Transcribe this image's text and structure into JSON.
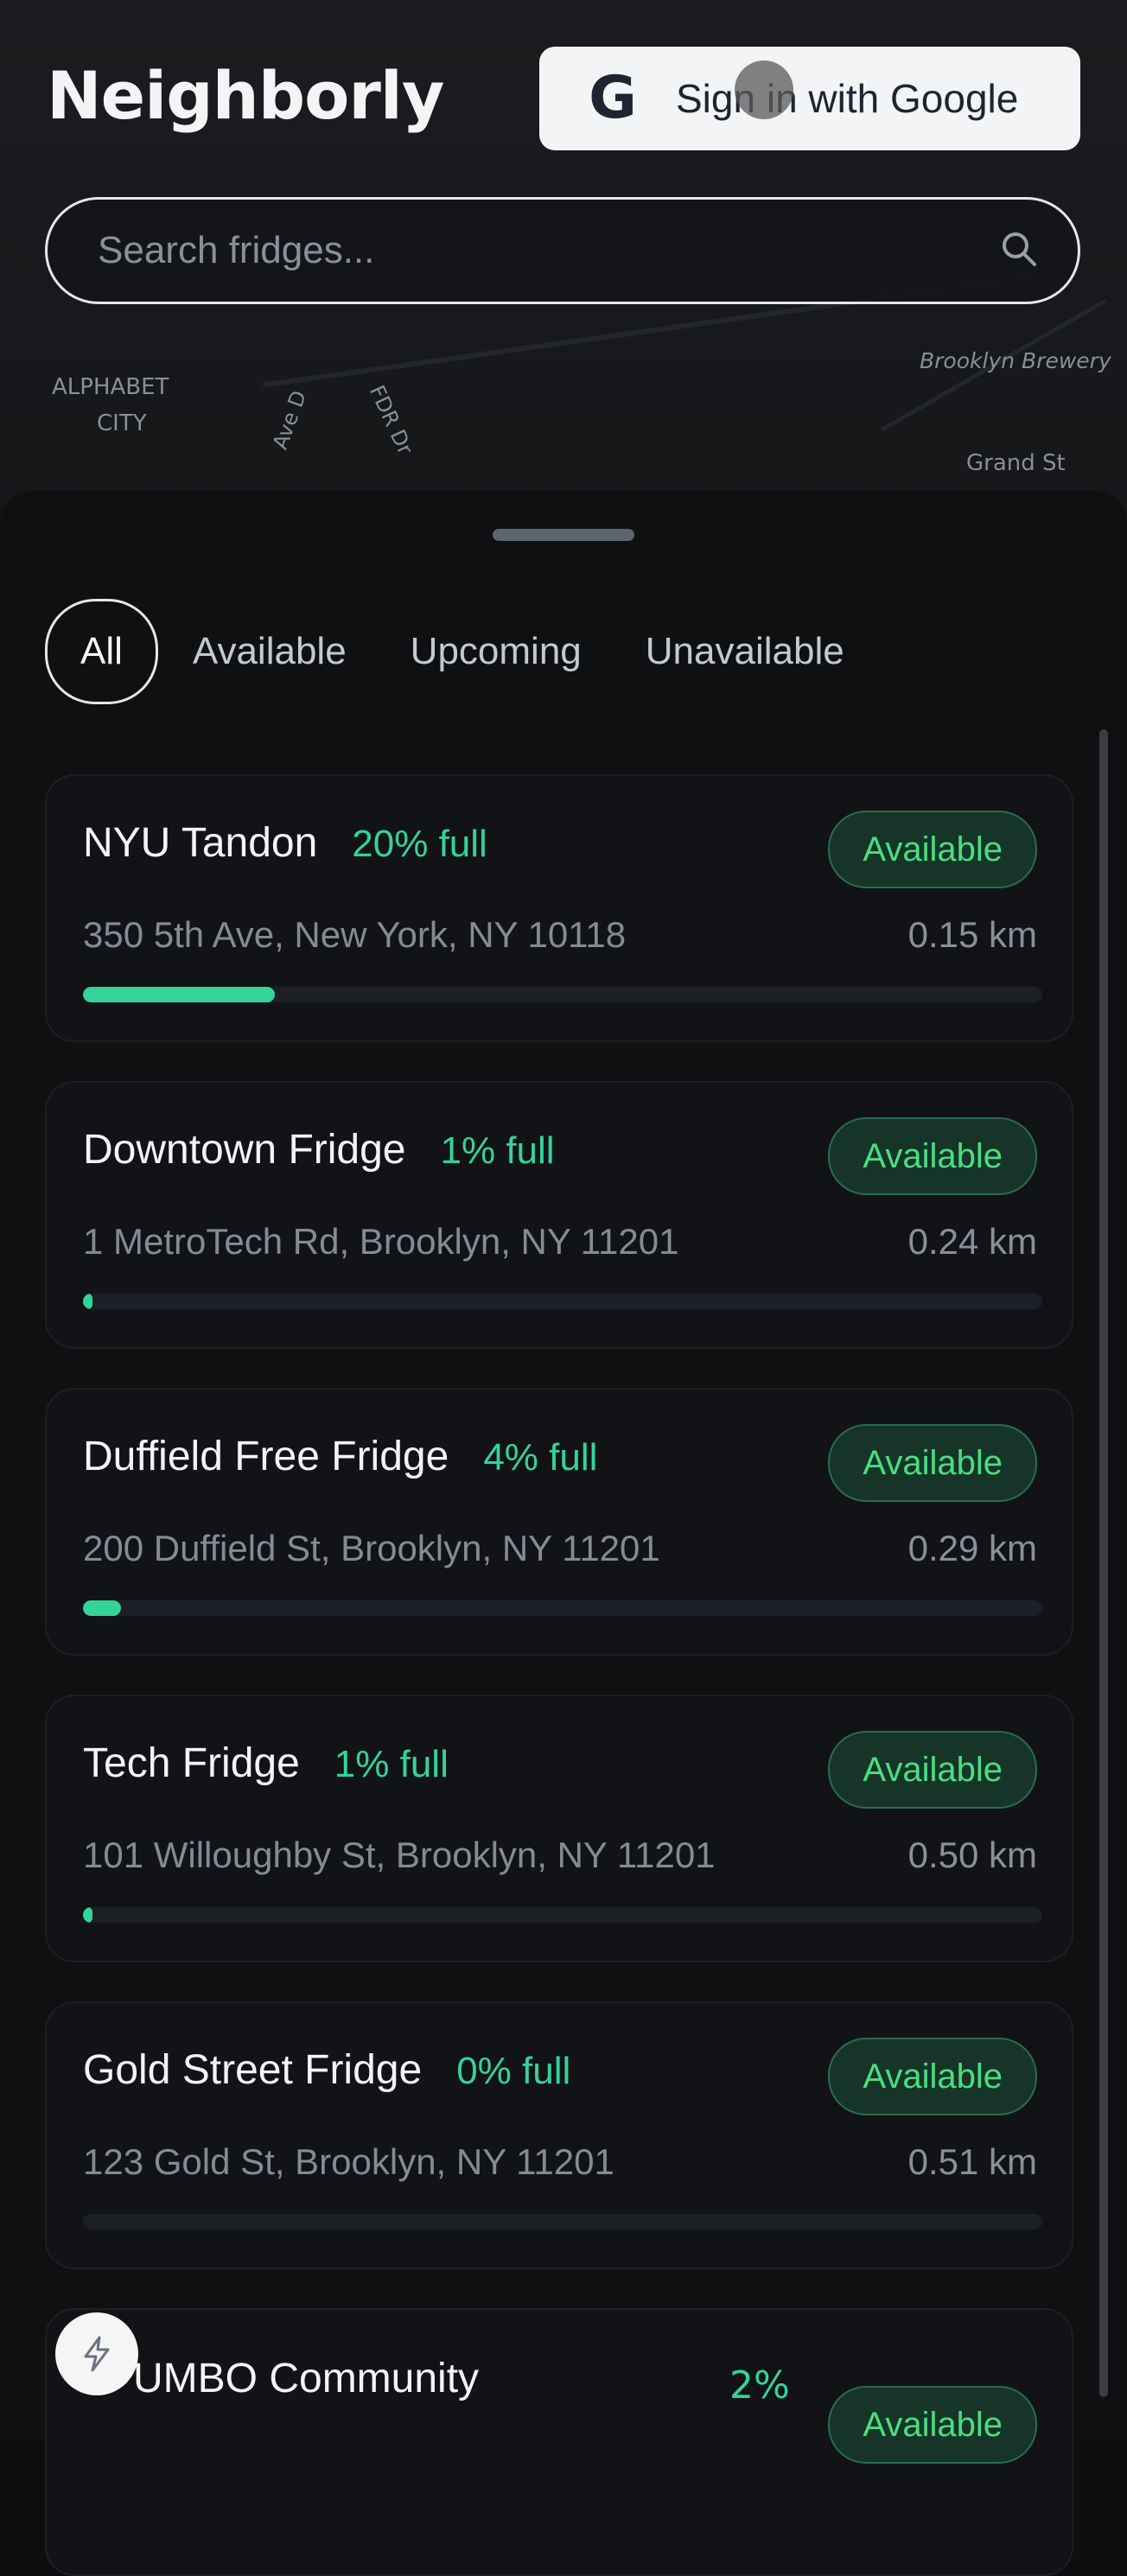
{
  "app": {
    "title": "Neighborly"
  },
  "auth": {
    "google_label": "Sign in with Google",
    "google_glyph": "G"
  },
  "search": {
    "placeholder": "Search fridges..."
  },
  "map": {
    "labels": [
      "ALPHABET",
      "CITY",
      "Ave D",
      "FDR Dr",
      "Brooklyn Brewery",
      "Grand St"
    ]
  },
  "filters": {
    "tabs": [
      "All",
      "Available",
      "Upcoming",
      "Unavailable"
    ],
    "active": "All"
  },
  "fridges": [
    {
      "name": "NYU Tandon",
      "fullness": "20% full",
      "fill": 0.2,
      "status": "Available",
      "address": "350 5th Ave, New York, NY 10118",
      "distance": "0.15 km"
    },
    {
      "name": "Downtown Fridge",
      "fullness": "1% full",
      "fill": 0.01,
      "status": "Available",
      "address": "1 MetroTech Rd, Brooklyn, NY 11201",
      "distance": "0.24 km"
    },
    {
      "name": "Duffield Free Fridge",
      "fullness": "4% full",
      "fill": 0.04,
      "status": "Available",
      "address": "200 Duffield St, Brooklyn, NY 11201",
      "distance": "0.29 km"
    },
    {
      "name": "Tech Fridge",
      "fullness": "1% full",
      "fill": 0.01,
      "status": "Available",
      "address": "101 Willoughby St, Brooklyn, NY 11201",
      "distance": "0.50 km"
    },
    {
      "name": "Gold Street Fridge",
      "fullness": "0% full",
      "fill": 0.0,
      "status": "Available",
      "address": "123 Gold St, Brooklyn, NY 11201",
      "distance": "0.51 km"
    },
    {
      "name": "UMBO Community",
      "fullness": "2%",
      "fill": 0.02,
      "status": "Available",
      "address": "",
      "distance": ""
    }
  ],
  "colors": {
    "accent": "#34d399",
    "badge_bg": "#163528",
    "background": "#0d0e10"
  }
}
